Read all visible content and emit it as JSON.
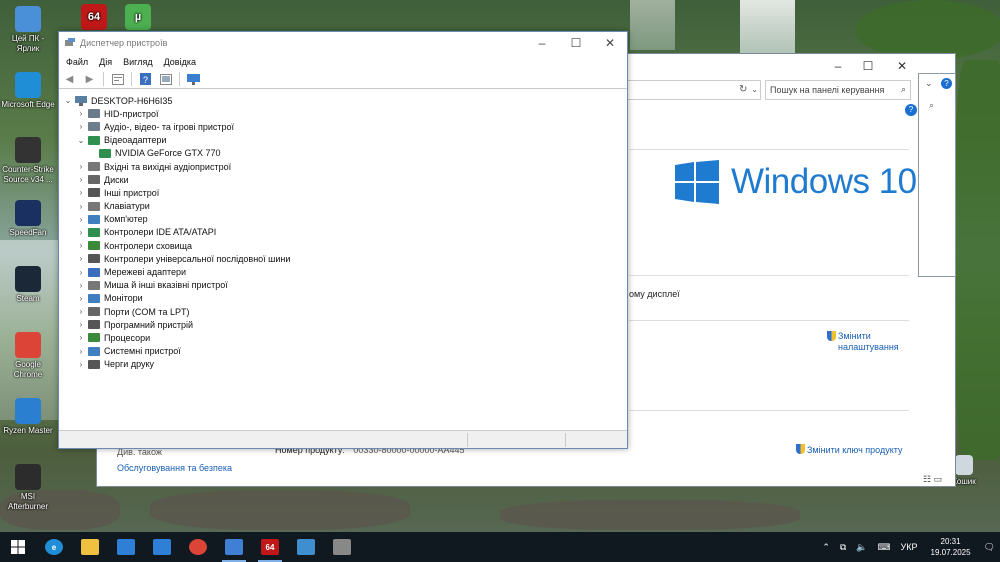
{
  "desktop": {
    "icons": [
      {
        "label": "Цей ПК - Ярлик",
        "color": "#4a90d9"
      },
      {
        "label": "Microsoft Edge",
        "color": "#1f8ed6"
      },
      {
        "label": "Counter-Strike Source v34 ...",
        "color": "#333333"
      },
      {
        "label": "SpeedFan",
        "color": "#1a3060"
      },
      {
        "label": "Steam",
        "color": "#1b2838"
      },
      {
        "label": "Google Chrome",
        "color": "#db4437"
      },
      {
        "label": "Ryzen Master",
        "color": "#2a7fd0"
      },
      {
        "label": "MSI Afterburner",
        "color": "#2c2c2c"
      }
    ],
    "recycle_bin": "Кошик"
  },
  "control_panel": {
    "search_placeholder": "Пошук на панелі керування",
    "windows_brand": "Windows 10",
    "display_text": "ому дисплеї",
    "change_settings": "Змінити налаштування",
    "see_also": "Див. також",
    "security_link": "Обслуговування та безпека",
    "product_id_label": "Номер продукту:",
    "product_id_value": "00330-80000-00000-AA445",
    "change_key": "Змінити ключ продукту"
  },
  "device_manager": {
    "title": "Диспетчер пристроїв",
    "menu": [
      "Файл",
      "Дія",
      "Вигляд",
      "Довідка"
    ],
    "root": "DESKTOP-H6H6I35",
    "tree": [
      {
        "label": "HID-пристрої",
        "expanded": false,
        "color": "#6b7b8b"
      },
      {
        "label": "Аудіо-, відео- та ігрові пристрої",
        "expanded": false,
        "color": "#6e7d8c"
      },
      {
        "label": "Відеоадаптери",
        "expanded": true,
        "color": "#2f8f4e"
      },
      {
        "label": "NVIDIA GeForce GTX 770",
        "child": true,
        "color": "#2f8f4e"
      },
      {
        "label": "Вхідні та вихідні аудіопристрої",
        "expanded": false,
        "color": "#777777"
      },
      {
        "label": "Диски",
        "expanded": false,
        "color": "#666666"
      },
      {
        "label": "Інші пристрої",
        "expanded": false,
        "color": "#555555"
      },
      {
        "label": "Клавіатури",
        "expanded": false,
        "color": "#777777"
      },
      {
        "label": "Комп'ютер",
        "expanded": false,
        "color": "#3f7fbf"
      },
      {
        "label": "Контролери IDE ATA/ATAPI",
        "expanded": false,
        "color": "#2f8f4e"
      },
      {
        "label": "Контролери сховища",
        "expanded": false,
        "color": "#3a8a3a"
      },
      {
        "label": "Контролери універсальної послідовної шини",
        "expanded": false,
        "color": "#555555"
      },
      {
        "label": "Мережеві адаптери",
        "expanded": false,
        "color": "#3a6fbf"
      },
      {
        "label": "Миша й інші вказівні пристрої",
        "expanded": false,
        "color": "#777777"
      },
      {
        "label": "Монітори",
        "expanded": false,
        "color": "#3f7fbf"
      },
      {
        "label": "Порти (COM та LPT)",
        "expanded": false,
        "color": "#666666"
      },
      {
        "label": "Програмний пристрій",
        "expanded": false,
        "color": "#555555"
      },
      {
        "label": "Процесори",
        "expanded": false,
        "color": "#3a8a3a"
      },
      {
        "label": "Системні пристрої",
        "expanded": false,
        "color": "#3f7fbf"
      },
      {
        "label": "Черги друку",
        "expanded": false,
        "color": "#555555"
      }
    ]
  },
  "taskbar": {
    "apps": [
      {
        "name": "start",
        "color": "#ffffff",
        "text": ""
      },
      {
        "name": "edge",
        "color": "#1f8ed6",
        "text": "e"
      },
      {
        "name": "explorer",
        "color": "#f0c040",
        "text": ""
      },
      {
        "name": "store",
        "color": "#2f7fd6",
        "text": ""
      },
      {
        "name": "mail",
        "color": "#2f7fd6",
        "text": ""
      },
      {
        "name": "chrome",
        "color": "#db4437",
        "text": ""
      },
      {
        "name": "paint",
        "color": "#3f7fd6",
        "text": ""
      },
      {
        "name": "aida64",
        "color": "#c01818",
        "text": "64"
      },
      {
        "name": "control-panel",
        "color": "#3f8fd0",
        "text": ""
      },
      {
        "name": "device-manager",
        "color": "#888888",
        "text": ""
      }
    ],
    "language": "УКР",
    "time": "20:31",
    "date": "19.07.2025"
  }
}
